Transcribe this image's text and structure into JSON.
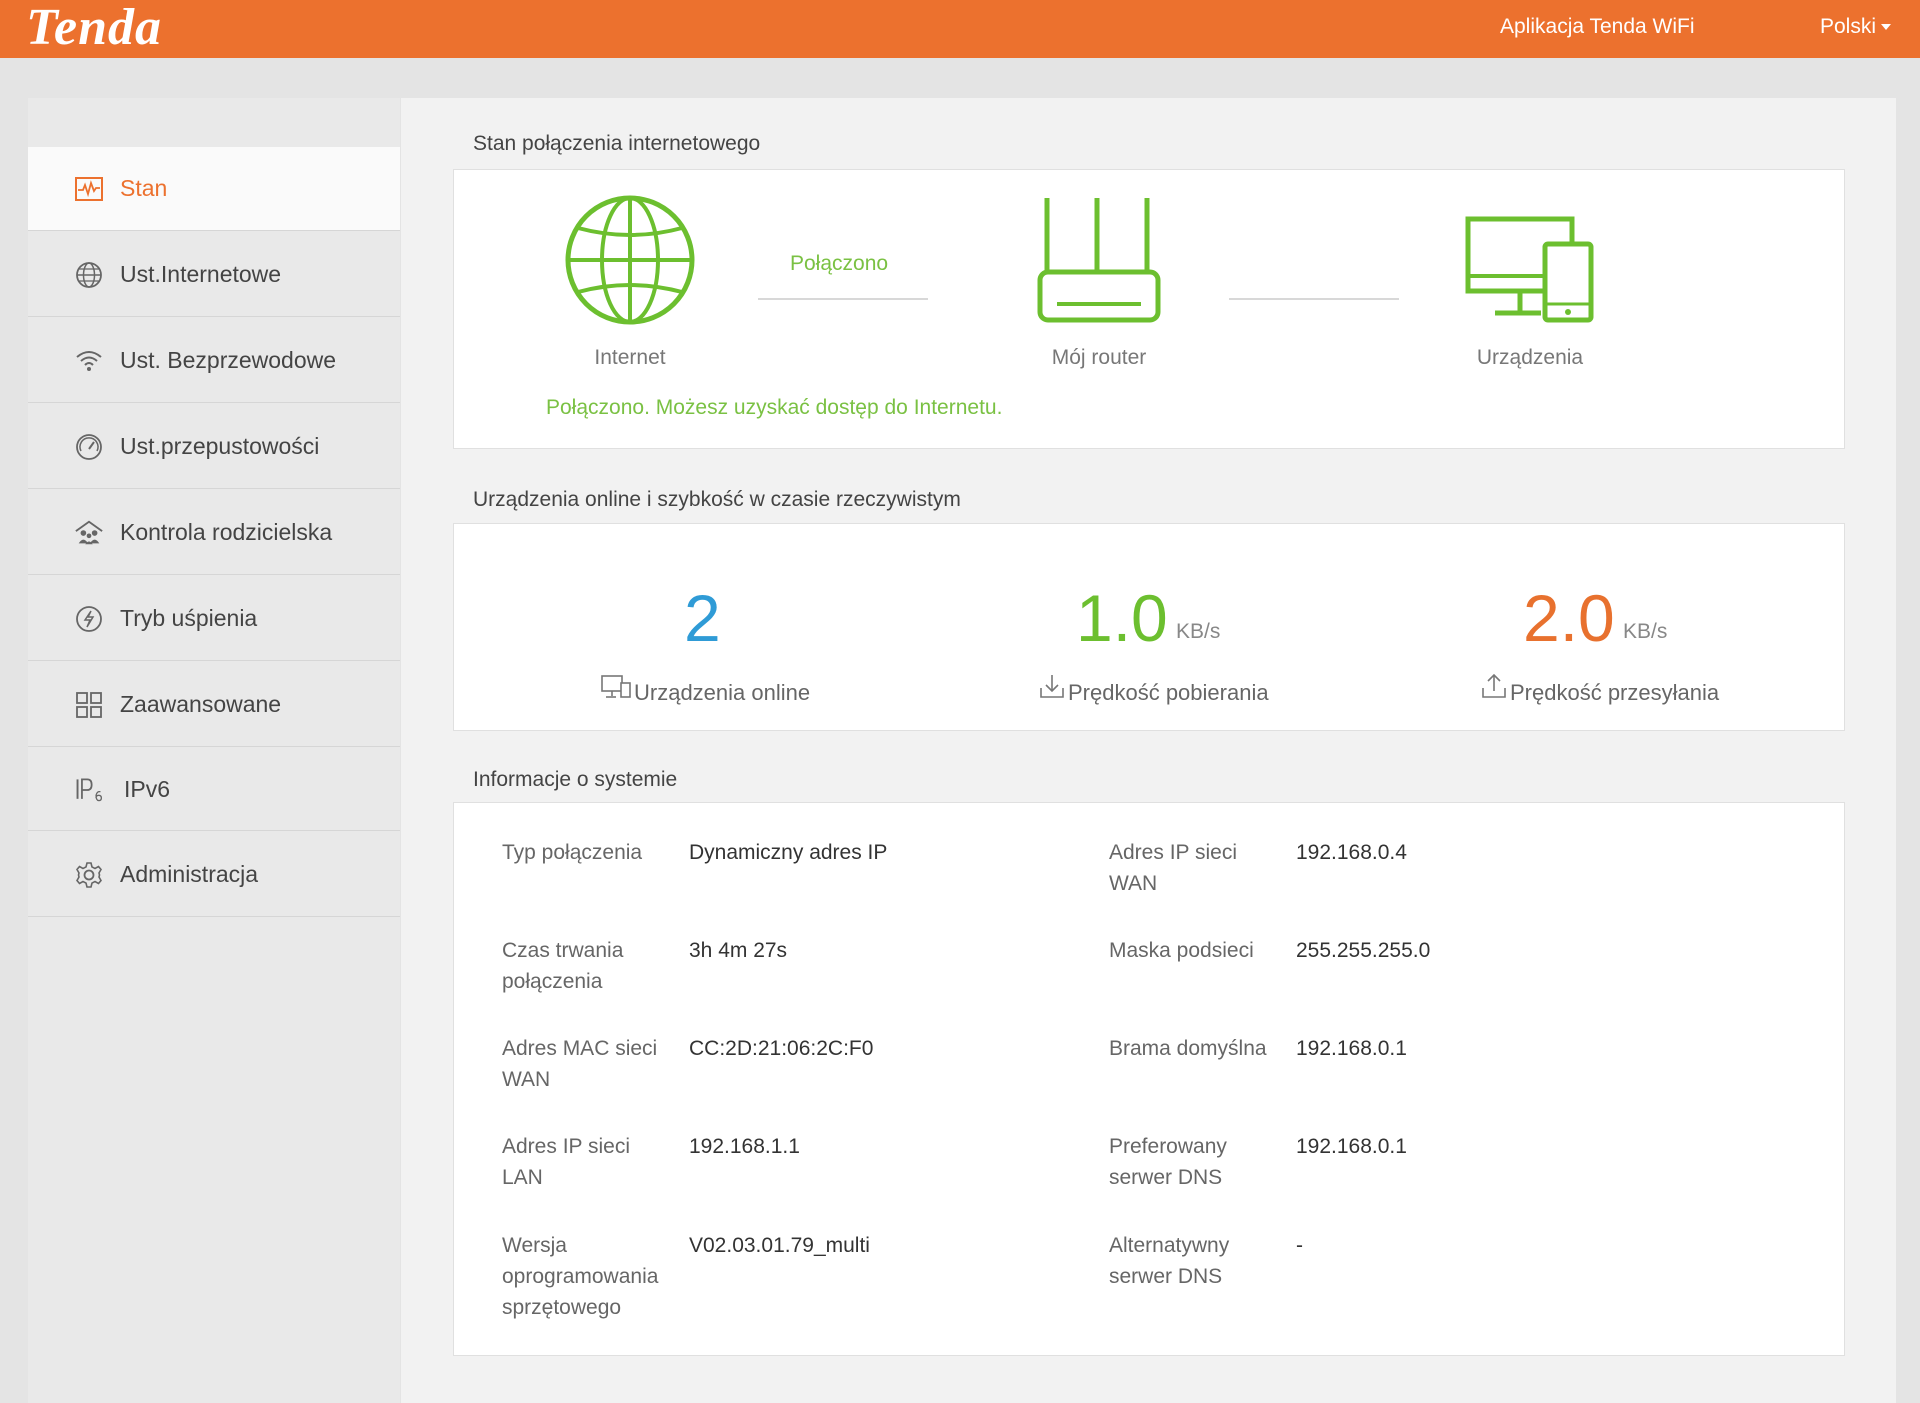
{
  "header": {
    "logo": "Tenda",
    "app_link": "Aplikacja Tenda WiFi",
    "language": "Polski"
  },
  "sidebar": {
    "items": [
      {
        "label": "Stan",
        "icon": "status-icon",
        "active": true
      },
      {
        "label": "Ust.Internetowe",
        "icon": "globe-icon"
      },
      {
        "label": "Ust. Bezprzewodowe",
        "icon": "wifi-icon"
      },
      {
        "label": "Ust.przepustowości",
        "icon": "speedometer-icon"
      },
      {
        "label": "Kontrola rodzicielska",
        "icon": "family-icon"
      },
      {
        "label": "Tryb uśpienia",
        "icon": "sleep-icon"
      },
      {
        "label": "Zaawansowane",
        "icon": "grid-icon"
      },
      {
        "label": "IPv6",
        "icon": "ipv6-icon"
      },
      {
        "label": "Administracja",
        "icon": "gear-icon"
      }
    ]
  },
  "connection": {
    "title": "Stan połączenia internetowego",
    "internet_label": "Internet",
    "router_label": "Mój router",
    "devices_label": "Urządzenia",
    "link_status": "Połączono",
    "message": "Połączono. Możesz uzyskać dostęp do Internetu."
  },
  "realtime": {
    "title": "Urządzenia online i szybkość w czasie rzeczywistym",
    "online_count": "2",
    "online_label": "Urządzenia online",
    "download_value": "1.0",
    "download_unit": "KB/s",
    "download_label": "Prędkość pobierania",
    "upload_value": "2.0",
    "upload_unit": "KB/s",
    "upload_label": "Prędkość przesyłania"
  },
  "system": {
    "title": "Informacje o systemie",
    "left": [
      {
        "key": "Typ połączenia",
        "value": "Dynamiczny adres IP"
      },
      {
        "key": "Czas trwania połączenia",
        "value": "3h 4m 27s"
      },
      {
        "key": "Adres MAC sieci WAN",
        "value": "CC:2D:21:06:2C:F0"
      },
      {
        "key": "Adres IP sieci LAN",
        "value": "192.168.1.1"
      },
      {
        "key": "Wersja oprogramowania sprzętowego",
        "value": "V02.03.01.79_multi"
      }
    ],
    "right": [
      {
        "key": "Adres IP sieci WAN",
        "value": "192.168.0.4"
      },
      {
        "key": "Maska podsieci",
        "value": "255.255.255.0"
      },
      {
        "key": "Brama domyślna",
        "value": "192.168.0.1"
      },
      {
        "key": "Preferowany serwer DNS",
        "value": "192.168.0.1"
      },
      {
        "key": "Alternatywny serwer DNS",
        "value": "-"
      }
    ]
  },
  "colors": {
    "brand": "#ec712e",
    "connected": "#7ac143",
    "online": "#2f9bd6",
    "download": "#6cbf2f",
    "upload": "#e8712e"
  }
}
